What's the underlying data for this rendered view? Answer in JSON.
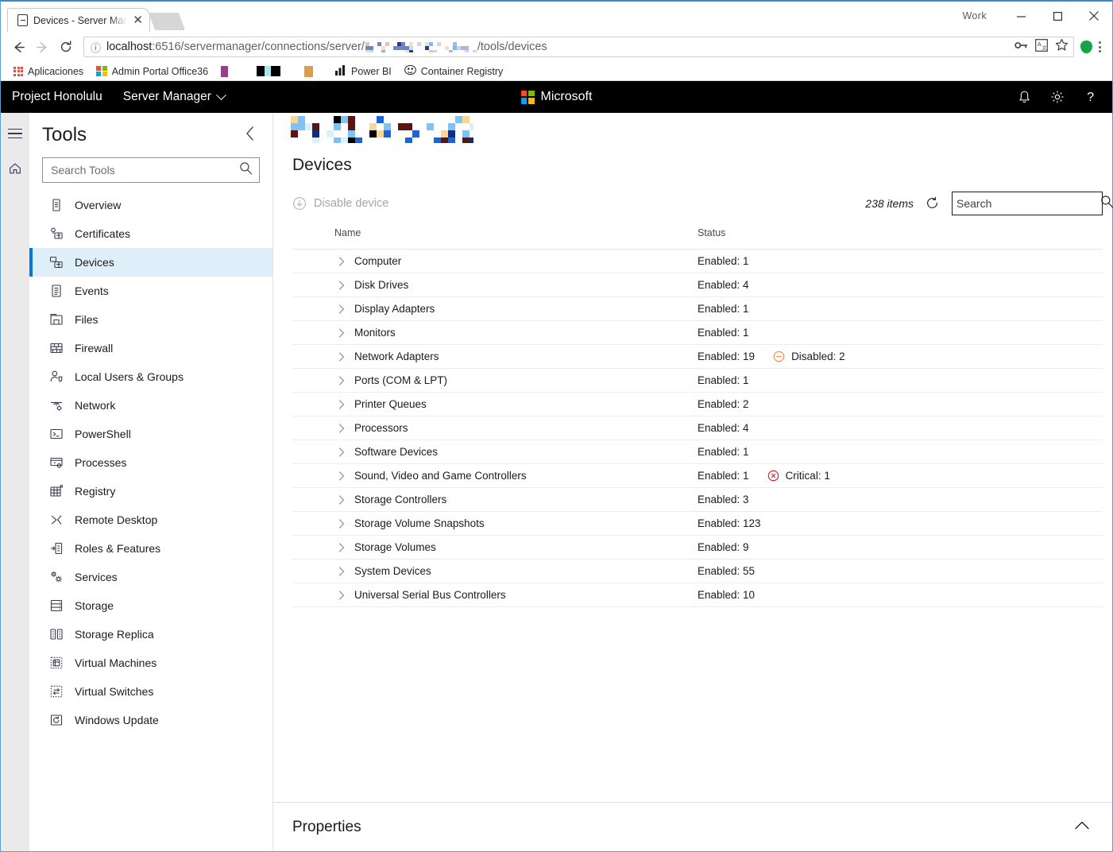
{
  "browser": {
    "window_label": "Work",
    "tab": {
      "title": "Devices - Server Manage",
      "close_label": "✕",
      "favicon": "device-icon"
    },
    "nav": {
      "back_icon": "back-arrow-icon",
      "forward_icon": "forward-arrow-icon",
      "reload_icon": "reload-icon"
    },
    "omnibox": {
      "info_icon": "info-circle-icon",
      "url_host": "localhost",
      "url_mid": ":6516/servermanager/connections/server/",
      "url_end": "/tools/devices",
      "key_icon": "password-key-icon",
      "translate_icon": "translate-icon",
      "star_icon": "bookmark-star-icon",
      "profile_icon": "profile-avatar-icon",
      "menu_icon": "chrome-menu-icon"
    },
    "bookmarks": [
      {
        "label": "Aplicaciones",
        "icon": "apps-grid-icon"
      },
      {
        "label": "Admin Portal Office36",
        "icon": "microsoft-logo-icon"
      },
      {
        "label": "",
        "icon": "purple-swatch-icon"
      },
      {
        "label": "",
        "icon": "black-cyan-swatch-icon"
      },
      {
        "label": "",
        "icon": "orange-swatch-icon"
      },
      {
        "label": "Power BI",
        "icon": "bar-chart-icon"
      },
      {
        "label": "Container Registry",
        "icon": "container-registry-icon"
      }
    ]
  },
  "topbar": {
    "brand": "Project Honolulu",
    "tool_selector": "Server Manager",
    "microsoft_label": "Microsoft",
    "actions": [
      {
        "name": "notifications-button",
        "icon": "bell-icon"
      },
      {
        "name": "settings-button",
        "icon": "gear-icon"
      },
      {
        "name": "help-button",
        "icon": "question-mark-icon"
      }
    ]
  },
  "rail": {
    "menu_icon": "hamburger-menu-icon",
    "home_icon": "home-icon"
  },
  "sidebar": {
    "title": "Tools",
    "collapse_icon": "chevron-left-icon",
    "search_placeholder": "Search Tools",
    "search_value": "",
    "search_icon": "search-icon",
    "items": [
      {
        "label": "Overview",
        "icon": "overview-icon",
        "active": false
      },
      {
        "label": "Certificates",
        "icon": "certificates-icon",
        "active": false
      },
      {
        "label": "Devices",
        "icon": "devices-icon",
        "active": true
      },
      {
        "label": "Events",
        "icon": "events-icon",
        "active": false
      },
      {
        "label": "Files",
        "icon": "files-icon",
        "active": false
      },
      {
        "label": "Firewall",
        "icon": "firewall-icon",
        "active": false
      },
      {
        "label": "Local Users & Groups",
        "icon": "users-icon",
        "active": false
      },
      {
        "label": "Network",
        "icon": "network-icon",
        "active": false
      },
      {
        "label": "PowerShell",
        "icon": "powershell-icon",
        "active": false
      },
      {
        "label": "Processes",
        "icon": "processes-icon",
        "active": false
      },
      {
        "label": "Registry",
        "icon": "registry-icon",
        "active": false
      },
      {
        "label": "Remote Desktop",
        "icon": "remote-desktop-icon",
        "active": false
      },
      {
        "label": "Roles & Features",
        "icon": "roles-features-icon",
        "active": false
      },
      {
        "label": "Services",
        "icon": "services-icon",
        "active": false
      },
      {
        "label": "Storage",
        "icon": "storage-icon",
        "active": false
      },
      {
        "label": "Storage Replica",
        "icon": "storage-replica-icon",
        "active": false
      },
      {
        "label": "Virtual Machines",
        "icon": "virtual-machines-icon",
        "active": false
      },
      {
        "label": "Virtual Switches",
        "icon": "virtual-switches-icon",
        "active": false
      },
      {
        "label": "Windows Update",
        "icon": "windows-update-icon",
        "active": false
      }
    ]
  },
  "main": {
    "page_title": "Devices",
    "command": {
      "label": "Disable device",
      "icon": "disable-device-icon",
      "enabled": false
    },
    "items_count": "238 items",
    "refresh_icon": "refresh-icon",
    "search": {
      "placeholder": "Search",
      "value": "",
      "icon": "search-icon",
      "focused": true
    },
    "columns": [
      "Name",
      "Status"
    ],
    "rows": [
      {
        "name": "Computer",
        "status": "Enabled: 1",
        "extra": null,
        "extra_icon": null
      },
      {
        "name": "Disk Drives",
        "status": "Enabled: 4",
        "extra": null,
        "extra_icon": null
      },
      {
        "name": "Display Adapters",
        "status": "Enabled: 1",
        "extra": null,
        "extra_icon": null
      },
      {
        "name": "Monitors",
        "status": "Enabled: 1",
        "extra": null,
        "extra_icon": null
      },
      {
        "name": "Network Adapters",
        "status": "Enabled: 19",
        "extra": "Disabled: 2",
        "extra_icon": "disabled-icon"
      },
      {
        "name": "Ports (COM & LPT)",
        "status": "Enabled: 1",
        "extra": null,
        "extra_icon": null
      },
      {
        "name": "Printer Queues",
        "status": "Enabled: 2",
        "extra": null,
        "extra_icon": null
      },
      {
        "name": "Processors",
        "status": "Enabled: 4",
        "extra": null,
        "extra_icon": null
      },
      {
        "name": "Software Devices",
        "status": "Enabled: 1",
        "extra": null,
        "extra_icon": null
      },
      {
        "name": "Sound, Video and Game Controllers",
        "status": "Enabled: 1",
        "extra": "Critical: 1",
        "extra_icon": "critical-icon"
      },
      {
        "name": "Storage Controllers",
        "status": "Enabled: 3",
        "extra": null,
        "extra_icon": null
      },
      {
        "name": "Storage Volume Snapshots",
        "status": "Enabled: 123",
        "extra": null,
        "extra_icon": null
      },
      {
        "name": "Storage Volumes",
        "status": "Enabled: 9",
        "extra": null,
        "extra_icon": null
      },
      {
        "name": "System Devices",
        "status": "Enabled: 55",
        "extra": null,
        "extra_icon": null
      },
      {
        "name": "Universal Serial Bus Controllers",
        "status": "Enabled: 10",
        "extra": null,
        "extra_icon": null
      }
    ],
    "row_expand_icon": "chevron-right-icon"
  },
  "properties": {
    "title": "Properties",
    "collapse_icon": "chevron-up-icon"
  },
  "colors": {
    "accent": "#0078d4",
    "selected_bg": "#deeffa",
    "topbar_bg": "#000000",
    "disabled_orange": "#f08a4b",
    "critical_red": "#e81123"
  }
}
